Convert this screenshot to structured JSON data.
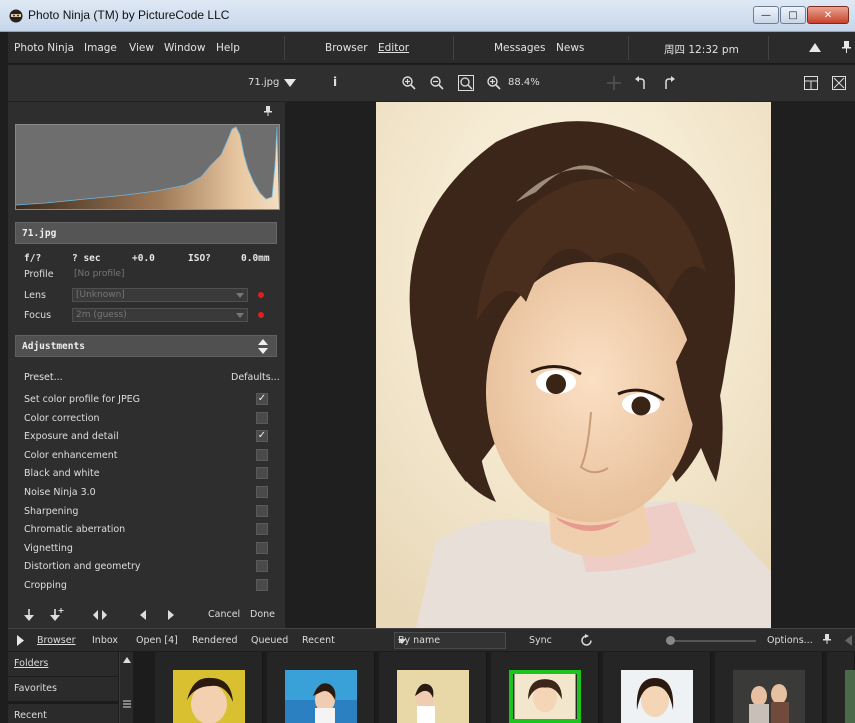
{
  "window": {
    "title": "Photo Ninja (TM) by PictureCode LLC"
  },
  "menu": {
    "items": [
      "Photo Ninja",
      "Image",
      "View",
      "Window",
      "Help"
    ],
    "browser": "Browser",
    "editor": "Editor",
    "messages": "Messages",
    "news": "News",
    "clock": "周四 12:32 pm"
  },
  "toolbar": {
    "filename": "71.jpg",
    "info": "i",
    "zoom": "88.4%"
  },
  "image_info": {
    "filename": "71.jpg",
    "aperture": "f/?",
    "shutter": "? sec",
    "exposure": "+0.0",
    "iso": "ISO?",
    "focal": "0.0mm",
    "profile_label": "Profile",
    "profile_value": "[No profile]",
    "lens_label": "Lens",
    "lens_value": "[Unknown]",
    "focus_label": "Focus",
    "focus_value": "2m (guess)"
  },
  "adjustments": {
    "header": "Adjustments",
    "preset": "Preset...",
    "defaults": "Defaults...",
    "items": [
      {
        "label": "Set color profile for JPEG",
        "checked": true
      },
      {
        "label": "Color correction",
        "checked": false
      },
      {
        "label": "Exposure and detail",
        "checked": true
      },
      {
        "label": "Color enhancement",
        "checked": false
      },
      {
        "label": "Black and white",
        "checked": false
      },
      {
        "label": "Noise Ninja 3.0",
        "checked": false
      },
      {
        "label": "Sharpening",
        "checked": false
      },
      {
        "label": "Chromatic aberration",
        "checked": false
      },
      {
        "label": "Vignetting",
        "checked": false
      },
      {
        "label": "Distortion and geometry",
        "checked": false
      },
      {
        "label": "Cropping",
        "checked": false
      }
    ],
    "cancel": "Cancel",
    "done": "Done"
  },
  "browserbar": {
    "browser": "Browser",
    "inbox": "Inbox",
    "open": "Open [4]",
    "rendered": "Rendered",
    "queued": "Queued",
    "recent": "Recent",
    "sort": "By name",
    "sync": "Sync",
    "options": "Options..."
  },
  "sidebar": {
    "folders": "Folders",
    "favorites": "Favorites",
    "recent": "Recent"
  },
  "colors": {
    "selected_thumb": "#1ec41e",
    "panel": "#2e2e2e",
    "dot": "#e02020"
  }
}
